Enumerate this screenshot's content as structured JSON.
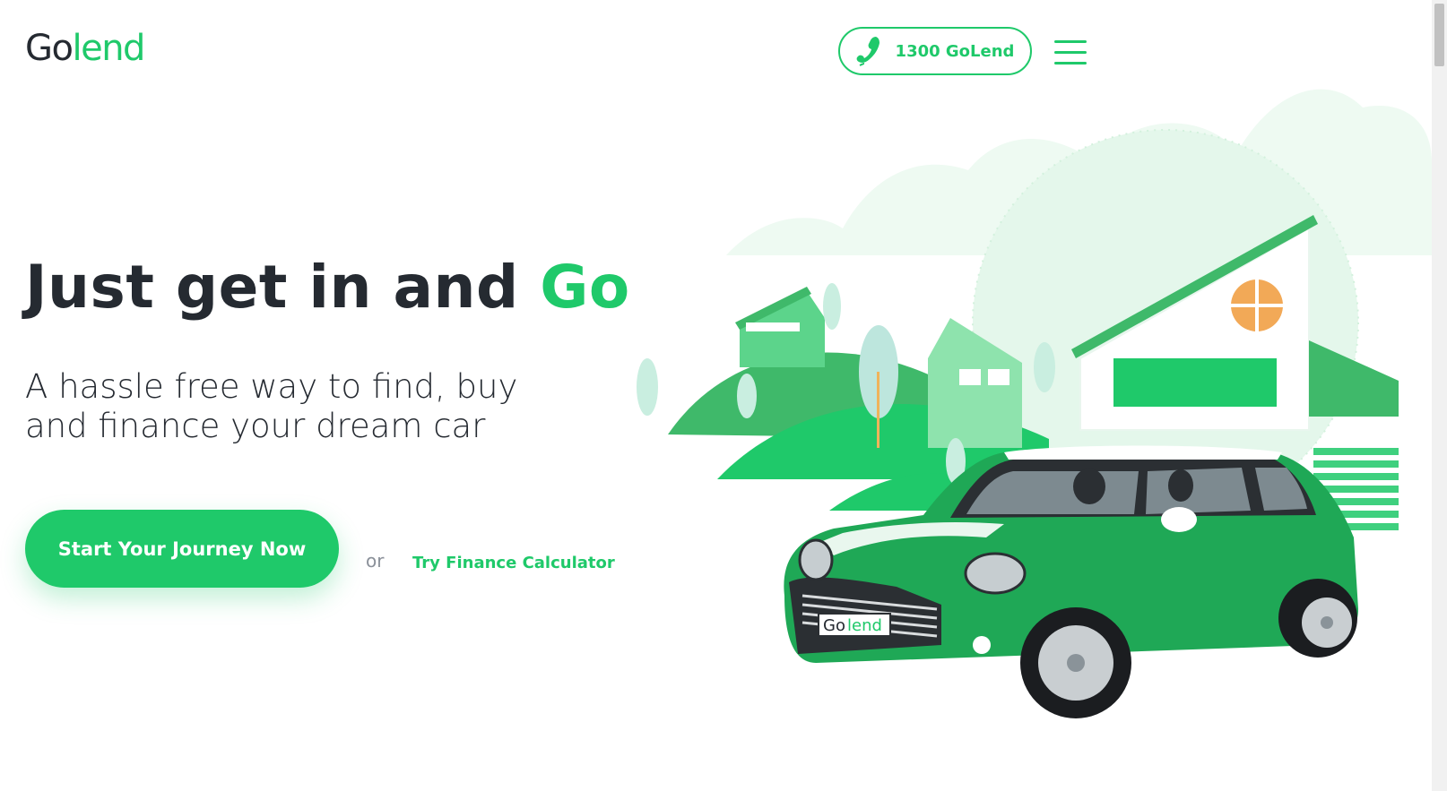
{
  "brand": {
    "logo_part1": "Go",
    "logo_part2": "lend"
  },
  "header": {
    "phone_label": "1300 GoLend"
  },
  "hero": {
    "headline_main": "Just get in and ",
    "headline_accent": "Go",
    "subhead": "A hassle free way to find, buy and finance your dream car",
    "cta_label": "Start Your Journey Now",
    "or_text": "or",
    "calculator_link": "Try Finance Calculator"
  },
  "illustration": {
    "plate_part1": "Go",
    "plate_part2": "lend"
  },
  "icons": [
    "phone-icon",
    "hamburger-menu-icon"
  ],
  "colors": {
    "accent": "#1fc96a",
    "text": "#252a31",
    "muted": "#8a9099",
    "light_green": "#e8f8ee"
  }
}
